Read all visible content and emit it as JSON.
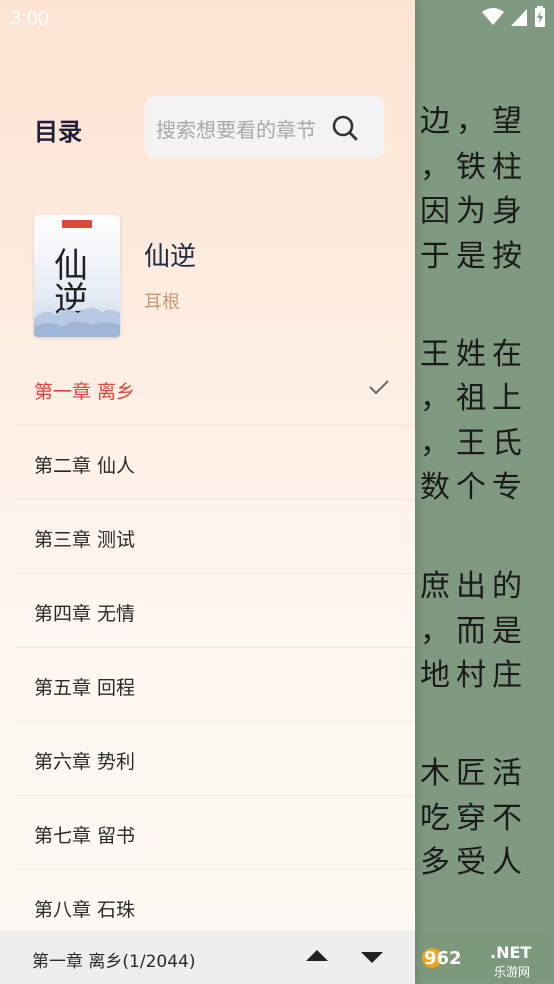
{
  "status_bar": {
    "time": "3:00"
  },
  "drawer": {
    "title": "目录",
    "search": {
      "placeholder": "搜索想要看的章节"
    },
    "book": {
      "name": "仙逆",
      "author": "耳根",
      "cover_title": "仙逆"
    },
    "chapters": [
      {
        "label": "第一章 离乡",
        "active": true
      },
      {
        "label": "第二章 仙人",
        "active": false
      },
      {
        "label": "第三章 测试",
        "active": false
      },
      {
        "label": "第四章 无情",
        "active": false
      },
      {
        "label": "第五章 回程",
        "active": false
      },
      {
        "label": "第六章 势利",
        "active": false
      },
      {
        "label": "第七章 留书",
        "active": false
      },
      {
        "label": "第八章 石珠",
        "active": false
      }
    ]
  },
  "bottom_bar": {
    "current": "第一章 离乡(1/2044)"
  },
  "reader": {
    "lines": [
      "边，望",
      "，铁柱",
      "因为身",
      "于是按",
      "王姓在",
      "，祖上",
      "，王氏",
      "数个专",
      "庶出的",
      "，而是",
      "地村庄",
      "木匠活",
      "吃穿不",
      "多受人"
    ]
  },
  "watermark": {
    "brand_number": "962",
    "brand_suffix": ".NET",
    "brand_sub": "乐游网"
  },
  "colors": {
    "accent": "#d9463c",
    "reader_bg": "#7f9a80",
    "author": "#c39c75"
  }
}
